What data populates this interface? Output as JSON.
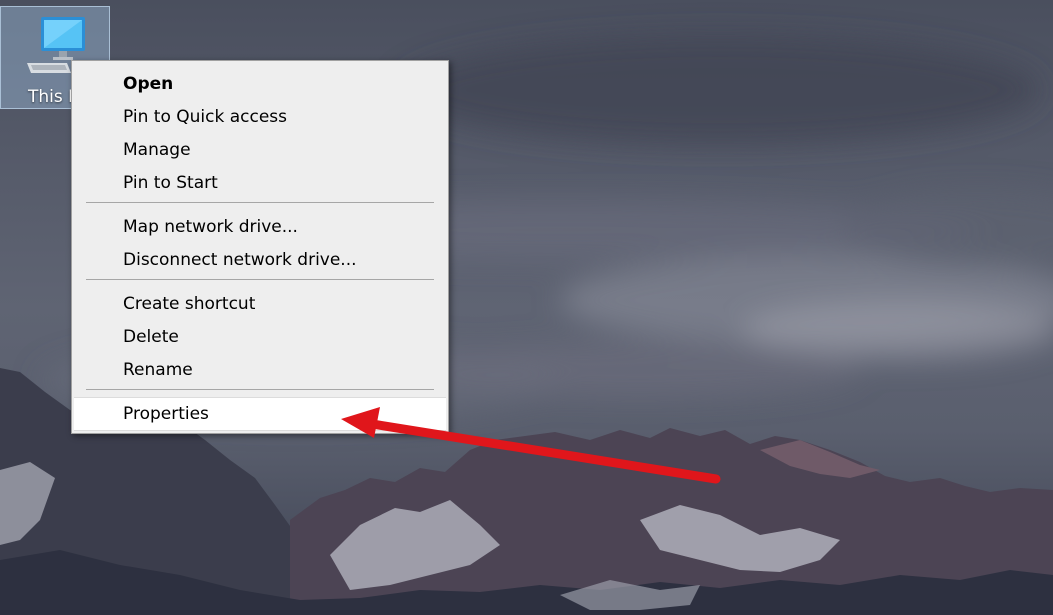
{
  "desktop": {
    "icons": [
      {
        "label": "This P",
        "icon": "computer-icon",
        "selected": true
      }
    ]
  },
  "context_menu": {
    "groups": [
      [
        {
          "label": "Open",
          "bold": true
        },
        {
          "label": "Pin to Quick access"
        },
        {
          "label": "Manage"
        },
        {
          "label": "Pin to Start"
        }
      ],
      [
        {
          "label": "Map network drive..."
        },
        {
          "label": "Disconnect network drive..."
        }
      ],
      [
        {
          "label": "Create shortcut"
        },
        {
          "label": "Delete"
        },
        {
          "label": "Rename"
        }
      ],
      [
        {
          "label": "Properties",
          "highlighted": true
        }
      ]
    ]
  },
  "annotation": {
    "arrow_color": "#e0161b",
    "points_to": "Properties"
  },
  "colors": {
    "menu_background": "#eeeeee",
    "menu_border": "#a0a0a0",
    "icon_selection": "#9ab8d6",
    "arrow": "#e0161b"
  }
}
